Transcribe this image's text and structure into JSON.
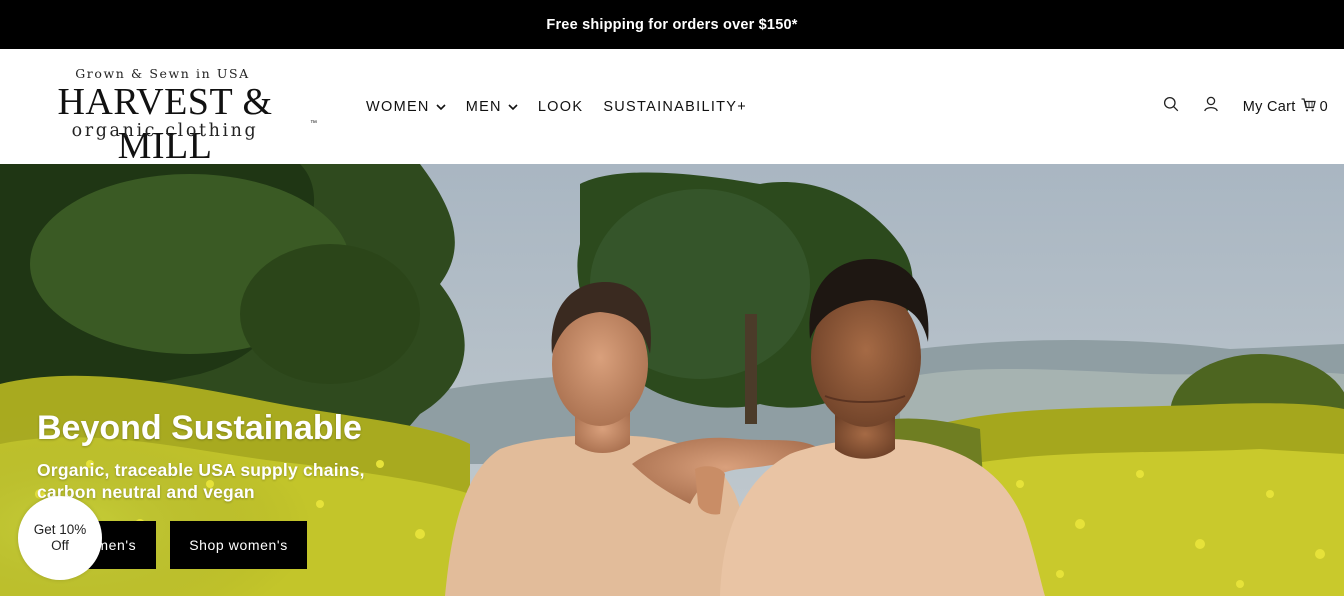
{
  "announcement": {
    "text": "Free shipping for orders over $150*"
  },
  "logo": {
    "tagline": "Grown & Sewn in USA",
    "name": "HARVEST & MILL",
    "subtitle": "organic clothing",
    "trademark": "™"
  },
  "nav": {
    "items": [
      {
        "label": "WOMEN",
        "has_dropdown": true
      },
      {
        "label": "MEN",
        "has_dropdown": true
      },
      {
        "label": "LOOK",
        "has_dropdown": false
      },
      {
        "label": "SUSTAINABILITY+",
        "has_dropdown": false
      }
    ]
  },
  "header_actions": {
    "search_icon": "search-icon",
    "account_icon": "user-icon",
    "cart_label": "My Cart",
    "cart_icon": "cart-icon",
    "cart_count": "0"
  },
  "hero": {
    "title": "Beyond Sustainable",
    "subtitle": "Organic, traceable USA supply chains, carbon neutral and vegan",
    "buttons": {
      "mens": "Shop men's",
      "womens": "Shop women's"
    }
  },
  "promo": {
    "line1": "Get 10%",
    "line2": "Off"
  },
  "colors": {
    "announcement_bg": "#000000",
    "button_bg": "#000000",
    "text_light": "#ffffff",
    "shirt": "#e8c4a4",
    "foliage_yellow": "#c8c82a",
    "sky": "#aebcc6"
  }
}
